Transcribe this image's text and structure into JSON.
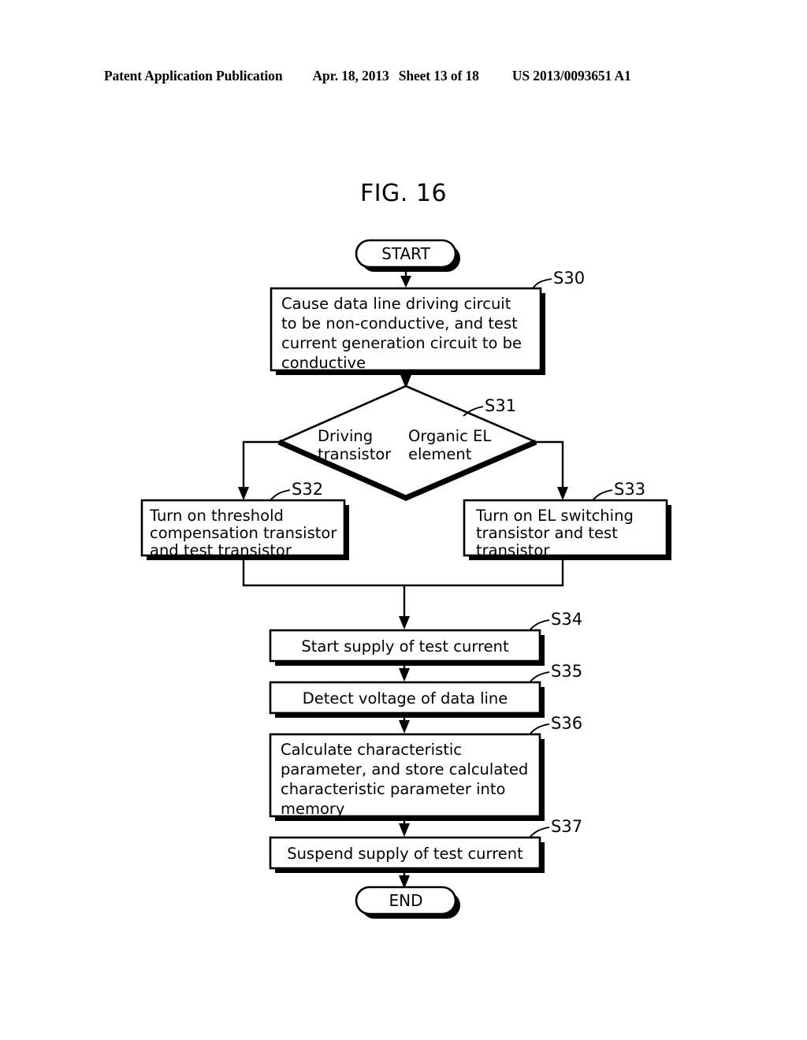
{
  "header": {
    "publication": "Patent Application Publication",
    "date": "Apr. 18, 2013",
    "sheet": "Sheet 13 of 18",
    "patent_number": "US 2013/0093651 A1"
  },
  "figure": {
    "title": "FIG. 16"
  },
  "flowchart": {
    "start_label": "START",
    "end_label": "END",
    "steps": {
      "s30": {
        "id": "S30",
        "lines": [
          "Cause data line driving circuit",
          "to be non-conductive, and test",
          "current generation circuit to be",
          "conductive"
        ]
      },
      "s31": {
        "id": "S31",
        "branch_left": [
          "Driving",
          "transistor"
        ],
        "branch_right": [
          "Organic EL",
          "element"
        ]
      },
      "s32": {
        "id": "S32",
        "lines": [
          "Turn on threshold",
          "compensation transistor",
          "and test transistor"
        ]
      },
      "s33": {
        "id": "S33",
        "lines": [
          "Turn on EL switching",
          "transistor and test",
          "transistor"
        ]
      },
      "s34": {
        "id": "S34",
        "lines": [
          "Start supply of test current"
        ]
      },
      "s35": {
        "id": "S35",
        "lines": [
          "Detect voltage of data line"
        ]
      },
      "s36": {
        "id": "S36",
        "lines": [
          "Calculate characteristic",
          "parameter, and store calculated",
          "characteristic parameter into",
          "memory"
        ]
      },
      "s37": {
        "id": "S37",
        "lines": [
          "Suspend supply of test current"
        ]
      }
    }
  },
  "colors": {
    "ink": "#000000",
    "paper": "#ffffff"
  }
}
